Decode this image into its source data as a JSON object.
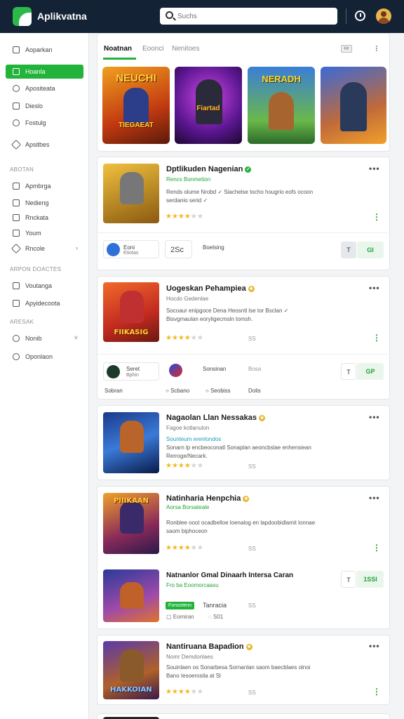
{
  "app": {
    "title": "Aplikvatna"
  },
  "search": {
    "placeholder": "Suchs"
  },
  "sidebar": {
    "items": [
      {
        "label": "Aoparkan"
      },
      {
        "label": "Hoanla"
      },
      {
        "label": "Apositeata"
      },
      {
        "label": "Dieslo"
      },
      {
        "label": "Fostulg"
      },
      {
        "label": "Apsitbes"
      }
    ],
    "section1": "ABOTAN",
    "items2": [
      {
        "label": "Apmbrga"
      },
      {
        "label": "Nedieng"
      },
      {
        "label": "Rnckata"
      },
      {
        "label": "Youm"
      },
      {
        "label": "Rncole"
      }
    ],
    "section2": "ARPON DOACTES",
    "items3": [
      {
        "label": "Voutanga"
      },
      {
        "label": "Apyidecoota"
      }
    ],
    "section3": "ARESAK",
    "items4": [
      {
        "label": "Nonib"
      },
      {
        "label": "Oponlaon"
      }
    ]
  },
  "tabs": {
    "items": [
      {
        "label": "Noatnan"
      },
      {
        "label": "Eoonci"
      },
      {
        "label": "Nenitoes"
      }
    ],
    "badge": "Hr"
  },
  "banners": [
    {
      "title": "NEUCHI",
      "sub": "TIEGAEAT"
    },
    {
      "title": "Fiartad"
    },
    {
      "title": "NERADH"
    },
    {
      "title": ""
    }
  ],
  "apps": [
    {
      "title": "Dptlikuden Nagenian",
      "sub": "Rencs Bonmetion",
      "desc": "Rends olume Nrobd ✓ Siachelse tocho hougrio eofs ocoon serdanio serid ✓",
      "stars_filled": 4,
      "count": "",
      "extra": {
        "name": "Eoni",
        "sub": "Etiotas",
        "mid": "2Sc",
        "tag": "Boelsing",
        "btn1": "T",
        "btn2": "GI"
      }
    },
    {
      "title": "Uogeskan Pehampiea",
      "sub": "Hocdo Gedenlae",
      "desc": "Socoaur enipgoce Dena Heosntl lse tor Bsclan ✓ Bisvgmaulan eoryligecmsln tomsh.",
      "stars_filled": 4,
      "count": "SS",
      "extra": {
        "name": "Seret",
        "sub": "Bphin",
        "mid": "Sonsinan",
        "tag": "Bosa",
        "btn1": "T",
        "btn2": "GP",
        "foot1": "Sobran",
        "foot2": "Scbano",
        "foot3": "Seobiss",
        "foot4": "Dolis"
      }
    },
    {
      "title": "Nagaolan Llan Nessakas",
      "sub": "Fagoe kotlanulon",
      "desc": "Sonarn lp encbeoconatl Sonaplan aeoncbslae enhensiean Rerroge/Necark.",
      "desc_green": "Sounteum erenlondos",
      "stars_filled": 4,
      "count": "SS"
    },
    {
      "title": "Natinharia Henpchia",
      "sub": "Aorsa Borsateale",
      "desc": "Ronblee ooot ocadbelloe loenalog en lapdoobidlamit lonnae saom biphoceon",
      "stars_filled": 4,
      "count": "SS"
    },
    {
      "title": "Natnanlor Gmal Dinaarh Intersa Caran",
      "sub": "Fro ba Eoomorcaasu",
      "tag": "Fonsotenn",
      "tag2": "Tanracia",
      "count": "SS",
      "meta1": "Eomiran",
      "meta2": "S01",
      "btn1": "T",
      "btn2": "1SSI"
    },
    {
      "title": "Nantiruana Bapadion",
      "sub": "Nomr Demdonlaes",
      "desc": "Souinlaen os Sonarbesa Sornanlan saom baecblaes olnoi Bano Iesoerosila at Sl",
      "stars_filled": 4,
      "count": "SS"
    }
  ],
  "colors": {
    "accent": "#22b43a",
    "topbar": "#142235",
    "star": "#f2b824"
  }
}
